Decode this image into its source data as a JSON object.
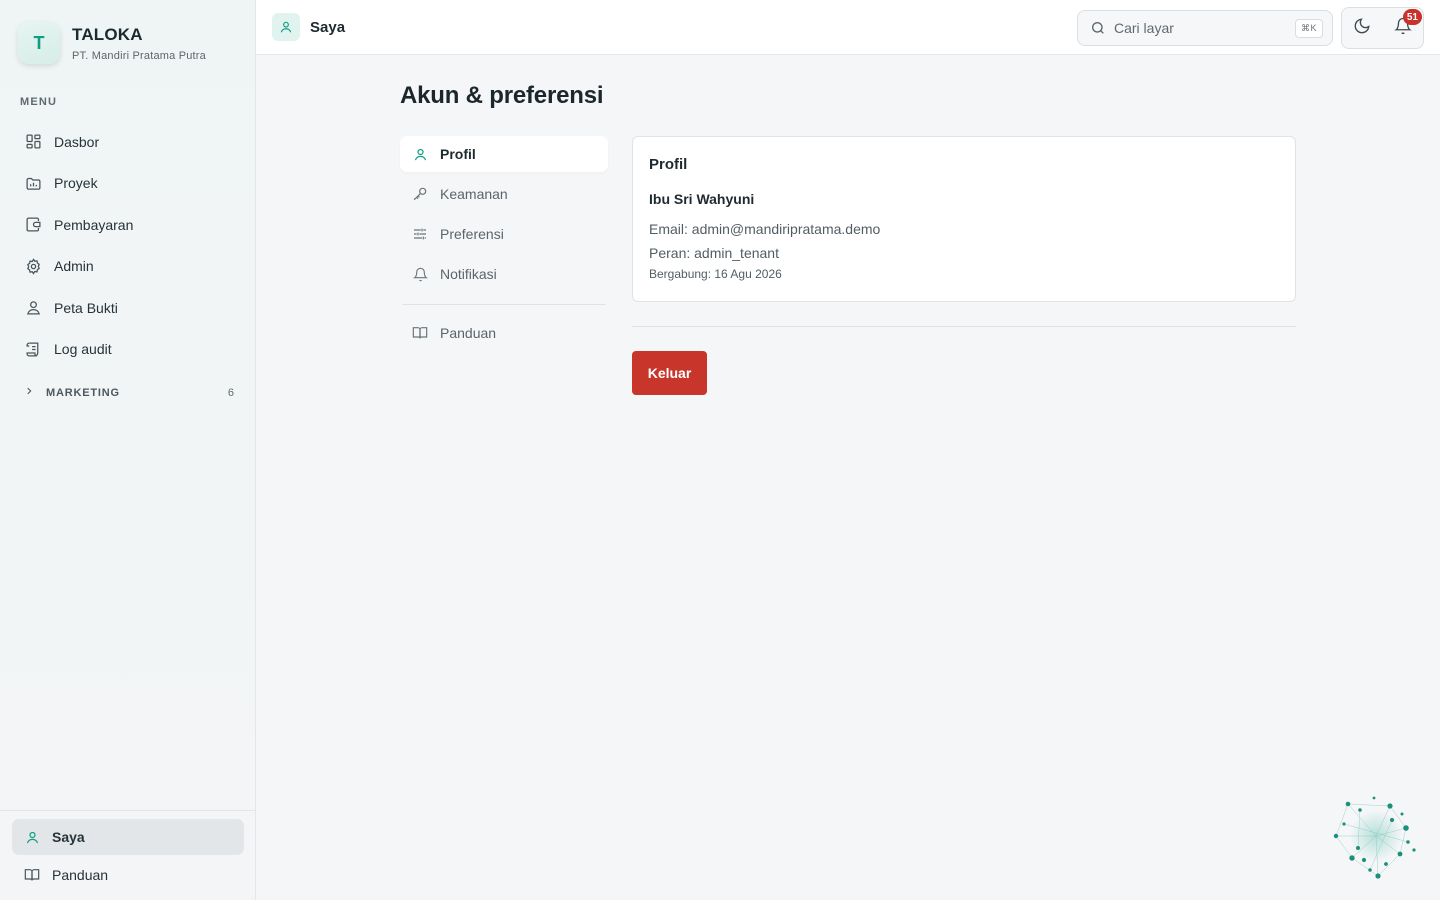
{
  "brand": {
    "initial": "T",
    "name": "TALOKA",
    "company": "PT. Mandiri Pratama Putra"
  },
  "sidebar": {
    "menu_label": "MENU",
    "items": [
      {
        "label": "Dasbor",
        "icon": "dashboard-icon"
      },
      {
        "label": "Proyek",
        "icon": "project-icon"
      },
      {
        "label": "Pembayaran",
        "icon": "wallet-icon"
      },
      {
        "label": "Admin",
        "icon": "gear-icon"
      },
      {
        "label": "Peta Bukti",
        "icon": "map-pin-icon"
      },
      {
        "label": "Log audit",
        "icon": "scroll-icon"
      }
    ],
    "section": {
      "label": "MARKETING",
      "count": "6"
    },
    "bottom": [
      {
        "label": "Saya",
        "icon": "user-icon",
        "active": true
      },
      {
        "label": "Panduan",
        "icon": "book-icon"
      }
    ]
  },
  "header": {
    "breadcrumb": "Saya",
    "search_placeholder": "Cari layar",
    "shortcut": "⌘K",
    "notification_count": "51"
  },
  "main": {
    "title": "Akun & preferensi",
    "tabs": [
      {
        "label": "Profil",
        "icon": "user-icon",
        "active": true
      },
      {
        "label": "Keamanan",
        "icon": "key-icon"
      },
      {
        "label": "Preferensi",
        "icon": "sliders-icon"
      },
      {
        "label": "Notifikasi",
        "icon": "bell-icon"
      }
    ],
    "extra_tab": {
      "label": "Panduan",
      "icon": "book-icon"
    },
    "profile": {
      "heading": "Profil",
      "name": "Ibu Sri Wahyuni",
      "email": "Email: admin@mandiripratama.demo",
      "role": "Peran: admin_tenant",
      "joined": "Bergabung: 16 Agu 2026"
    },
    "logout_label": "Keluar"
  },
  "colors": {
    "accent": "#0f9d84",
    "danger": "#c8352a",
    "badge": "#c8322a"
  }
}
